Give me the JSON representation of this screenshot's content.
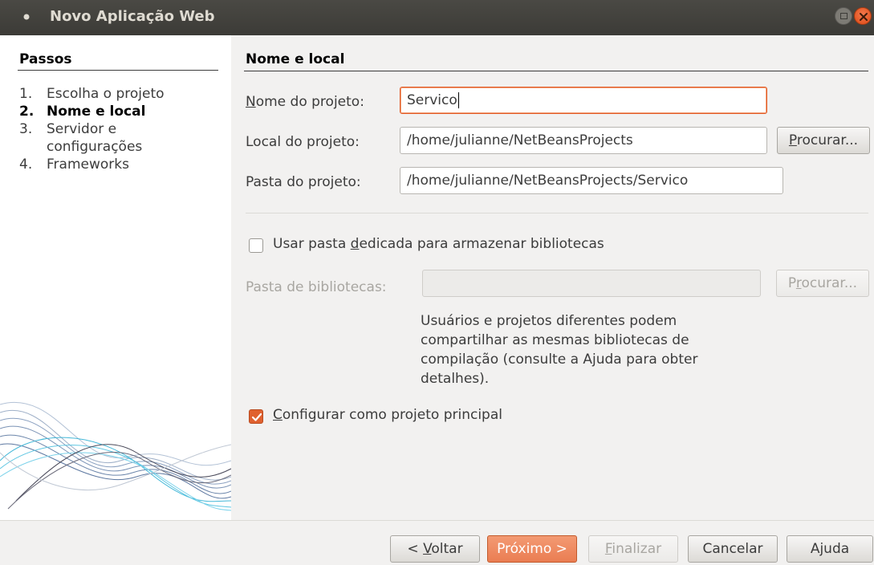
{
  "window": {
    "title": "Novo Aplicação Web"
  },
  "steps": {
    "heading": "Passos",
    "items": [
      {
        "num": "1.",
        "label": "Escolha o projeto"
      },
      {
        "num": "2.",
        "label": "Nome e local"
      },
      {
        "num": "3.",
        "label": "Servidor e configurações"
      },
      {
        "num": "4.",
        "label": "Frameworks"
      }
    ],
    "current_index": 1
  },
  "form": {
    "section_title": "Nome e local",
    "project_name": {
      "label_pre": "",
      "label_mnemonic": "N",
      "label_post": "ome do projeto:",
      "value": "Servico"
    },
    "project_location": {
      "label_pre": "Local do pro",
      "label_mnemonic": "j",
      "label_post": "eto:",
      "value": "/home/julianne/NetBeansProjects",
      "browse_pre": "",
      "browse_mnemonic": "P",
      "browse_post": "rocurar..."
    },
    "project_folder": {
      "label": "Pasta do projeto:",
      "value": "/home/julianne/NetBeansProjects/Servico"
    },
    "dedicated_folder": {
      "label_pre": "Usar pasta ",
      "label_mnemonic": "d",
      "label_post": "edicada para armazenar bibliotecas",
      "checked": false
    },
    "libraries_folder": {
      "label": "Pasta de bibliotecas:",
      "value": "",
      "browse_pre": "P",
      "browse_mnemonic": "r",
      "browse_post": "ocurar..."
    },
    "help_text": "Usuários e projetos diferentes podem compartilhar as mesmas bibliotecas de compilação (consulte a Ajuda para obter detalhes).",
    "main_project": {
      "label_pre": "",
      "label_mnemonic": "C",
      "label_post": "onfigurar como projeto principal",
      "checked": true
    }
  },
  "buttons": {
    "back_pre": "< ",
    "back_mnemonic": "V",
    "back_post": "oltar",
    "next": "Próximo >",
    "finish_mnemonic": "F",
    "finish_post": "inalizar",
    "cancel": "Cancelar",
    "help": "Ajuda"
  },
  "colors": {
    "accent": "#e25a25",
    "titlebar": "#3c3b37",
    "window_bg": "#f2f1f0"
  }
}
